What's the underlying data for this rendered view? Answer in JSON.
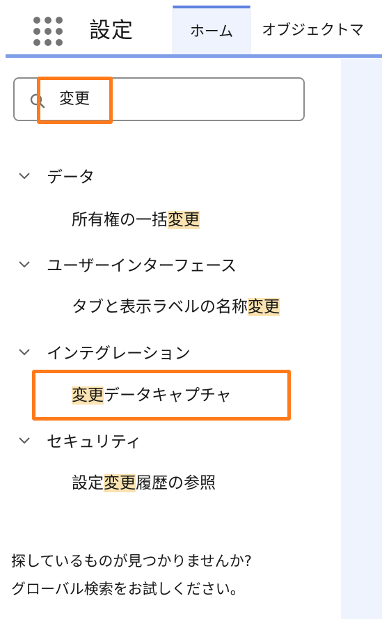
{
  "header": {
    "app_title": "設定",
    "launcher_icon": "app-launcher-grid-icon",
    "tabs": [
      {
        "label": "ホーム",
        "active": true
      },
      {
        "label": "オブジェクトマ",
        "active": false
      }
    ],
    "accent_color": "#5f80de"
  },
  "search": {
    "value": "変更",
    "icon": "search-icon"
  },
  "tree": {
    "groups": [
      {
        "label": "データ",
        "expanded": true,
        "items": [
          {
            "before": "所有権の一括",
            "match": "変更",
            "after": ""
          }
        ]
      },
      {
        "label": "ユーザーインターフェース",
        "expanded": true,
        "items": [
          {
            "before": "タブと表示ラベルの名称",
            "match": "変更",
            "after": ""
          }
        ]
      },
      {
        "label": "インテグレーション",
        "expanded": true,
        "items": [
          {
            "before": "",
            "match": "変更",
            "after": "データキャプチャ"
          }
        ]
      },
      {
        "label": "セキュリティ",
        "expanded": true,
        "items": [
          {
            "before": "設定",
            "match": "変更",
            "after": "履歴の参照"
          }
        ]
      }
    ]
  },
  "footer": {
    "line1": "探しているものが見つかりませんか?",
    "line2": "グローバル検索をお試しください。"
  },
  "colors": {
    "highlight": "#fbe3b1",
    "callout": "#ff7a1a",
    "panel": "#eef3fd"
  }
}
